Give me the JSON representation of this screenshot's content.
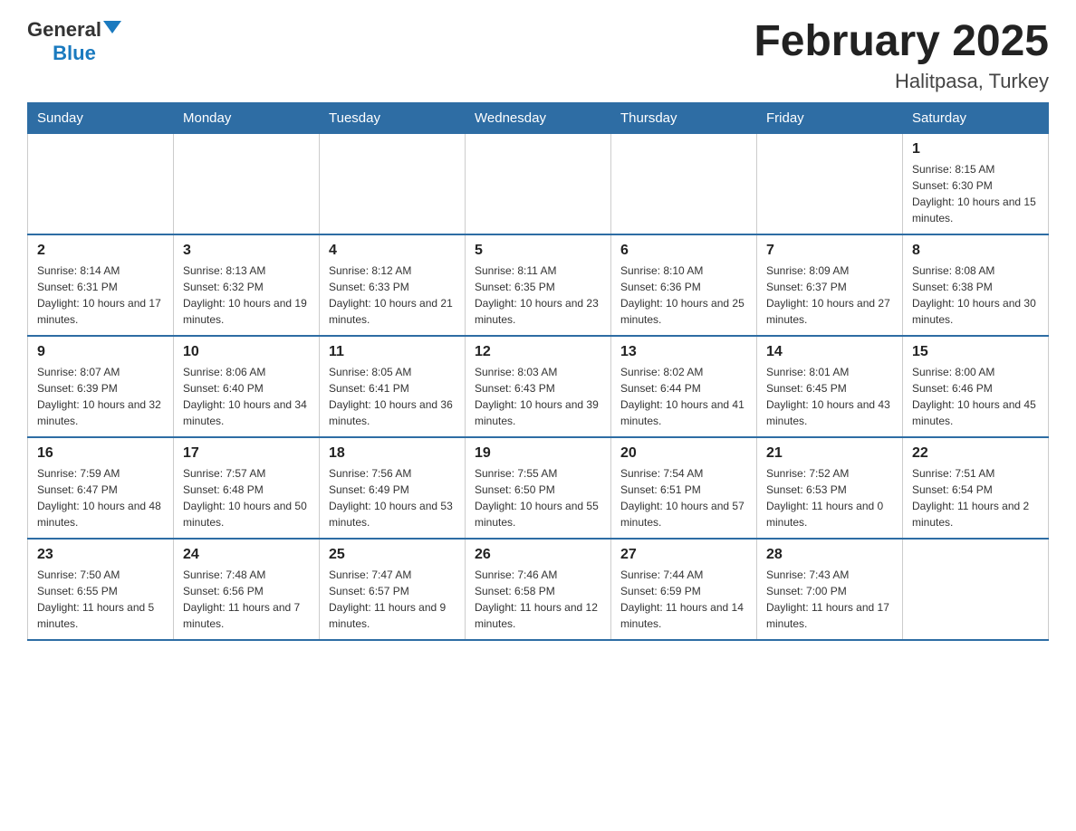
{
  "header": {
    "logo": {
      "general": "General",
      "blue": "Blue"
    },
    "title": "February 2025",
    "subtitle": "Halitpasa, Turkey"
  },
  "weekdays": [
    "Sunday",
    "Monday",
    "Tuesday",
    "Wednesday",
    "Thursday",
    "Friday",
    "Saturday"
  ],
  "weeks": [
    [
      {
        "day": "",
        "info": ""
      },
      {
        "day": "",
        "info": ""
      },
      {
        "day": "",
        "info": ""
      },
      {
        "day": "",
        "info": ""
      },
      {
        "day": "",
        "info": ""
      },
      {
        "day": "",
        "info": ""
      },
      {
        "day": "1",
        "info": "Sunrise: 8:15 AM\nSunset: 6:30 PM\nDaylight: 10 hours and 15 minutes."
      }
    ],
    [
      {
        "day": "2",
        "info": "Sunrise: 8:14 AM\nSunset: 6:31 PM\nDaylight: 10 hours and 17 minutes."
      },
      {
        "day": "3",
        "info": "Sunrise: 8:13 AM\nSunset: 6:32 PM\nDaylight: 10 hours and 19 minutes."
      },
      {
        "day": "4",
        "info": "Sunrise: 8:12 AM\nSunset: 6:33 PM\nDaylight: 10 hours and 21 minutes."
      },
      {
        "day": "5",
        "info": "Sunrise: 8:11 AM\nSunset: 6:35 PM\nDaylight: 10 hours and 23 minutes."
      },
      {
        "day": "6",
        "info": "Sunrise: 8:10 AM\nSunset: 6:36 PM\nDaylight: 10 hours and 25 minutes."
      },
      {
        "day": "7",
        "info": "Sunrise: 8:09 AM\nSunset: 6:37 PM\nDaylight: 10 hours and 27 minutes."
      },
      {
        "day": "8",
        "info": "Sunrise: 8:08 AM\nSunset: 6:38 PM\nDaylight: 10 hours and 30 minutes."
      }
    ],
    [
      {
        "day": "9",
        "info": "Sunrise: 8:07 AM\nSunset: 6:39 PM\nDaylight: 10 hours and 32 minutes."
      },
      {
        "day": "10",
        "info": "Sunrise: 8:06 AM\nSunset: 6:40 PM\nDaylight: 10 hours and 34 minutes."
      },
      {
        "day": "11",
        "info": "Sunrise: 8:05 AM\nSunset: 6:41 PM\nDaylight: 10 hours and 36 minutes."
      },
      {
        "day": "12",
        "info": "Sunrise: 8:03 AM\nSunset: 6:43 PM\nDaylight: 10 hours and 39 minutes."
      },
      {
        "day": "13",
        "info": "Sunrise: 8:02 AM\nSunset: 6:44 PM\nDaylight: 10 hours and 41 minutes."
      },
      {
        "day": "14",
        "info": "Sunrise: 8:01 AM\nSunset: 6:45 PM\nDaylight: 10 hours and 43 minutes."
      },
      {
        "day": "15",
        "info": "Sunrise: 8:00 AM\nSunset: 6:46 PM\nDaylight: 10 hours and 45 minutes."
      }
    ],
    [
      {
        "day": "16",
        "info": "Sunrise: 7:59 AM\nSunset: 6:47 PM\nDaylight: 10 hours and 48 minutes."
      },
      {
        "day": "17",
        "info": "Sunrise: 7:57 AM\nSunset: 6:48 PM\nDaylight: 10 hours and 50 minutes."
      },
      {
        "day": "18",
        "info": "Sunrise: 7:56 AM\nSunset: 6:49 PM\nDaylight: 10 hours and 53 minutes."
      },
      {
        "day": "19",
        "info": "Sunrise: 7:55 AM\nSunset: 6:50 PM\nDaylight: 10 hours and 55 minutes."
      },
      {
        "day": "20",
        "info": "Sunrise: 7:54 AM\nSunset: 6:51 PM\nDaylight: 10 hours and 57 minutes."
      },
      {
        "day": "21",
        "info": "Sunrise: 7:52 AM\nSunset: 6:53 PM\nDaylight: 11 hours and 0 minutes."
      },
      {
        "day": "22",
        "info": "Sunrise: 7:51 AM\nSunset: 6:54 PM\nDaylight: 11 hours and 2 minutes."
      }
    ],
    [
      {
        "day": "23",
        "info": "Sunrise: 7:50 AM\nSunset: 6:55 PM\nDaylight: 11 hours and 5 minutes."
      },
      {
        "day": "24",
        "info": "Sunrise: 7:48 AM\nSunset: 6:56 PM\nDaylight: 11 hours and 7 minutes."
      },
      {
        "day": "25",
        "info": "Sunrise: 7:47 AM\nSunset: 6:57 PM\nDaylight: 11 hours and 9 minutes."
      },
      {
        "day": "26",
        "info": "Sunrise: 7:46 AM\nSunset: 6:58 PM\nDaylight: 11 hours and 12 minutes."
      },
      {
        "day": "27",
        "info": "Sunrise: 7:44 AM\nSunset: 6:59 PM\nDaylight: 11 hours and 14 minutes."
      },
      {
        "day": "28",
        "info": "Sunrise: 7:43 AM\nSunset: 7:00 PM\nDaylight: 11 hours and 17 minutes."
      },
      {
        "day": "",
        "info": ""
      }
    ]
  ]
}
